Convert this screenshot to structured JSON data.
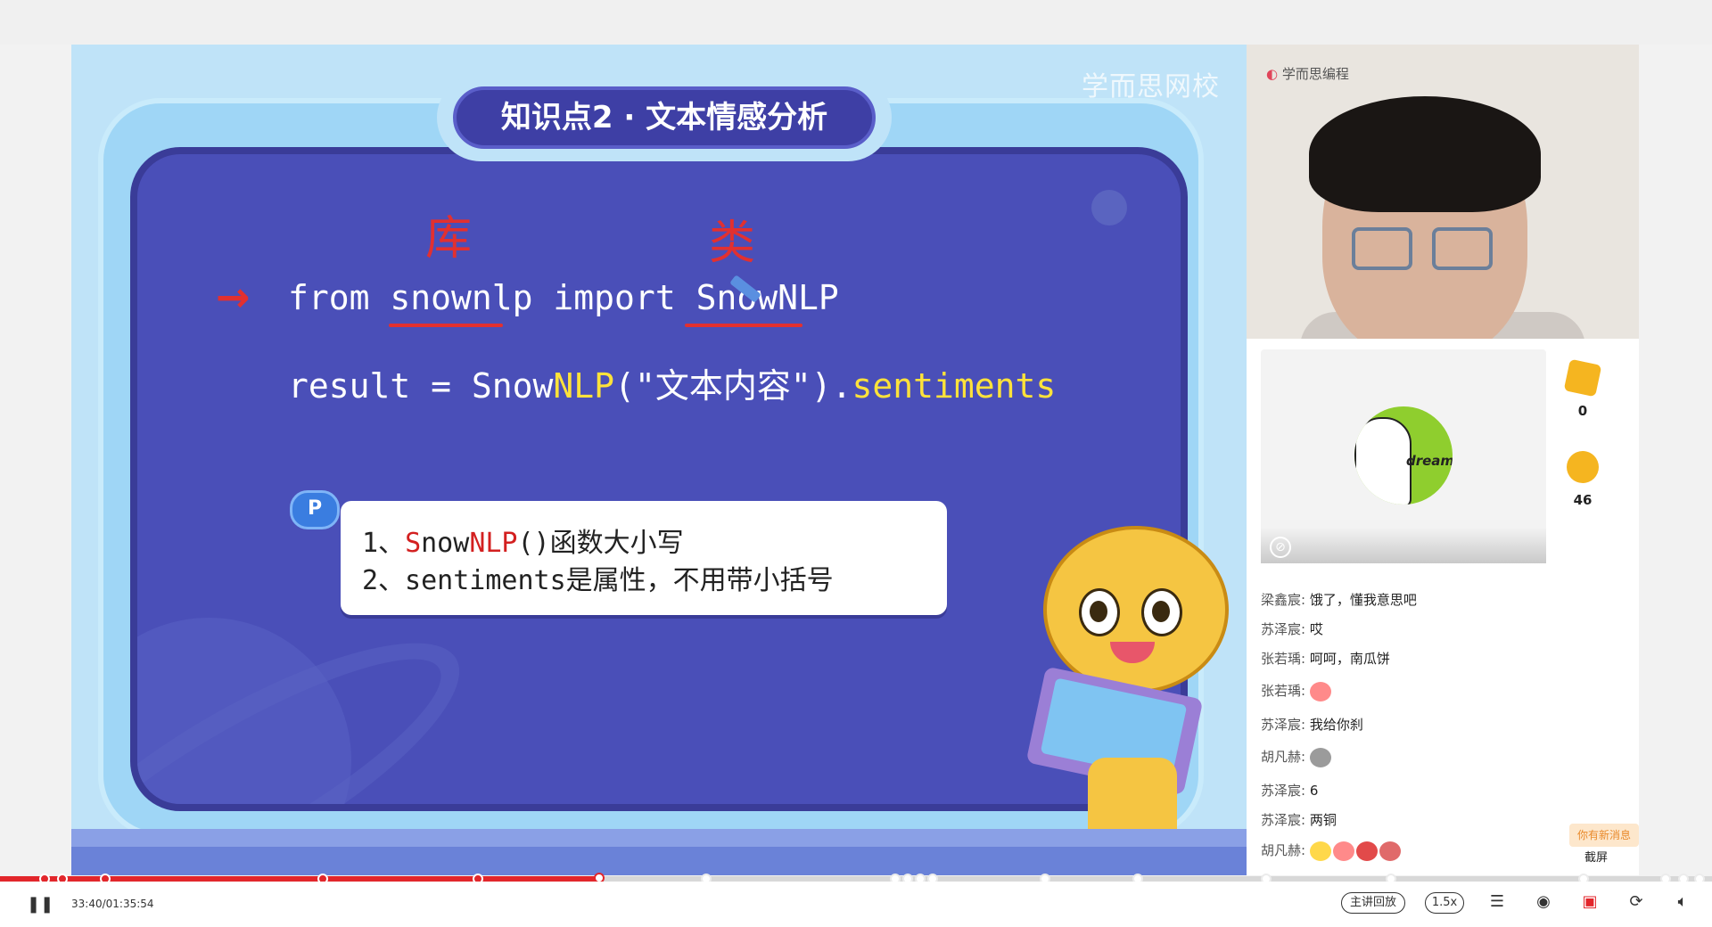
{
  "slide": {
    "title": "知识点2 · 文本情感分析",
    "watermark": "学而思网校",
    "code_line1_a": "from ",
    "code_line1_b": "snownlp",
    "code_line1_c": " import ",
    "code_line1_d": "SnowNLP",
    "code_line2_a": "result = Snow",
    "code_line2_b": "NLP",
    "code_line2_c": "(\"文本内容\").",
    "code_line2_d": "sentiments",
    "annotation_ku": "库",
    "annotation_lei": "类",
    "badge": "P",
    "note_line1_prefix": "1、",
    "note_line1_red1": "S",
    "note_line1_mid": "now",
    "note_line1_red2": "NLP",
    "note_line1_rest": "()函数大小写",
    "note_line2": "2、sentiments是属性，不用带小括号"
  },
  "right_panel": {
    "logo_text": "学而思编程",
    "avatar_label": "dream",
    "stats": [
      {
        "icon": "card-icon",
        "value": "0",
        "color": "#f5b520"
      },
      {
        "icon": "coin-icon",
        "value": "46",
        "color": "#f5b520"
      }
    ],
    "chat": [
      {
        "user": "梁鑫宸:",
        "text": "饿了，懂我意思吧"
      },
      {
        "user": "苏泽宸:",
        "text": "哎"
      },
      {
        "user": "张若瑀:",
        "text": "呵呵，南瓜饼"
      },
      {
        "user": "张若瑀:",
        "text": "",
        "emojis": [
          "laugh-emoji-icon"
        ]
      },
      {
        "user": "苏泽宸:",
        "text": "我给你刹"
      },
      {
        "user": "胡凡赫:",
        "text": "",
        "emojis": [
          "koala-emoji-icon"
        ]
      },
      {
        "user": "苏泽宸:",
        "text": "6"
      },
      {
        "user": "苏泽宸:",
        "text": "两铜"
      },
      {
        "user": "胡凡赫:",
        "text": "",
        "emojis": [
          "smile-emoji-icon",
          "laugh-emoji-icon",
          "cry-emoji-icon",
          "monkey-emoji-icon"
        ]
      }
    ],
    "new_message_tip": "你有新消息",
    "screenshot_label": "截屏"
  },
  "player": {
    "time": "33:40/01:35:54",
    "progress": 0.35,
    "mode_label": "主讲回放",
    "speed_label": "1.5x",
    "icons": [
      "pause-icon",
      "list-icon",
      "location-icon",
      "record-icon",
      "refresh-icon",
      "volume-icon"
    ]
  }
}
